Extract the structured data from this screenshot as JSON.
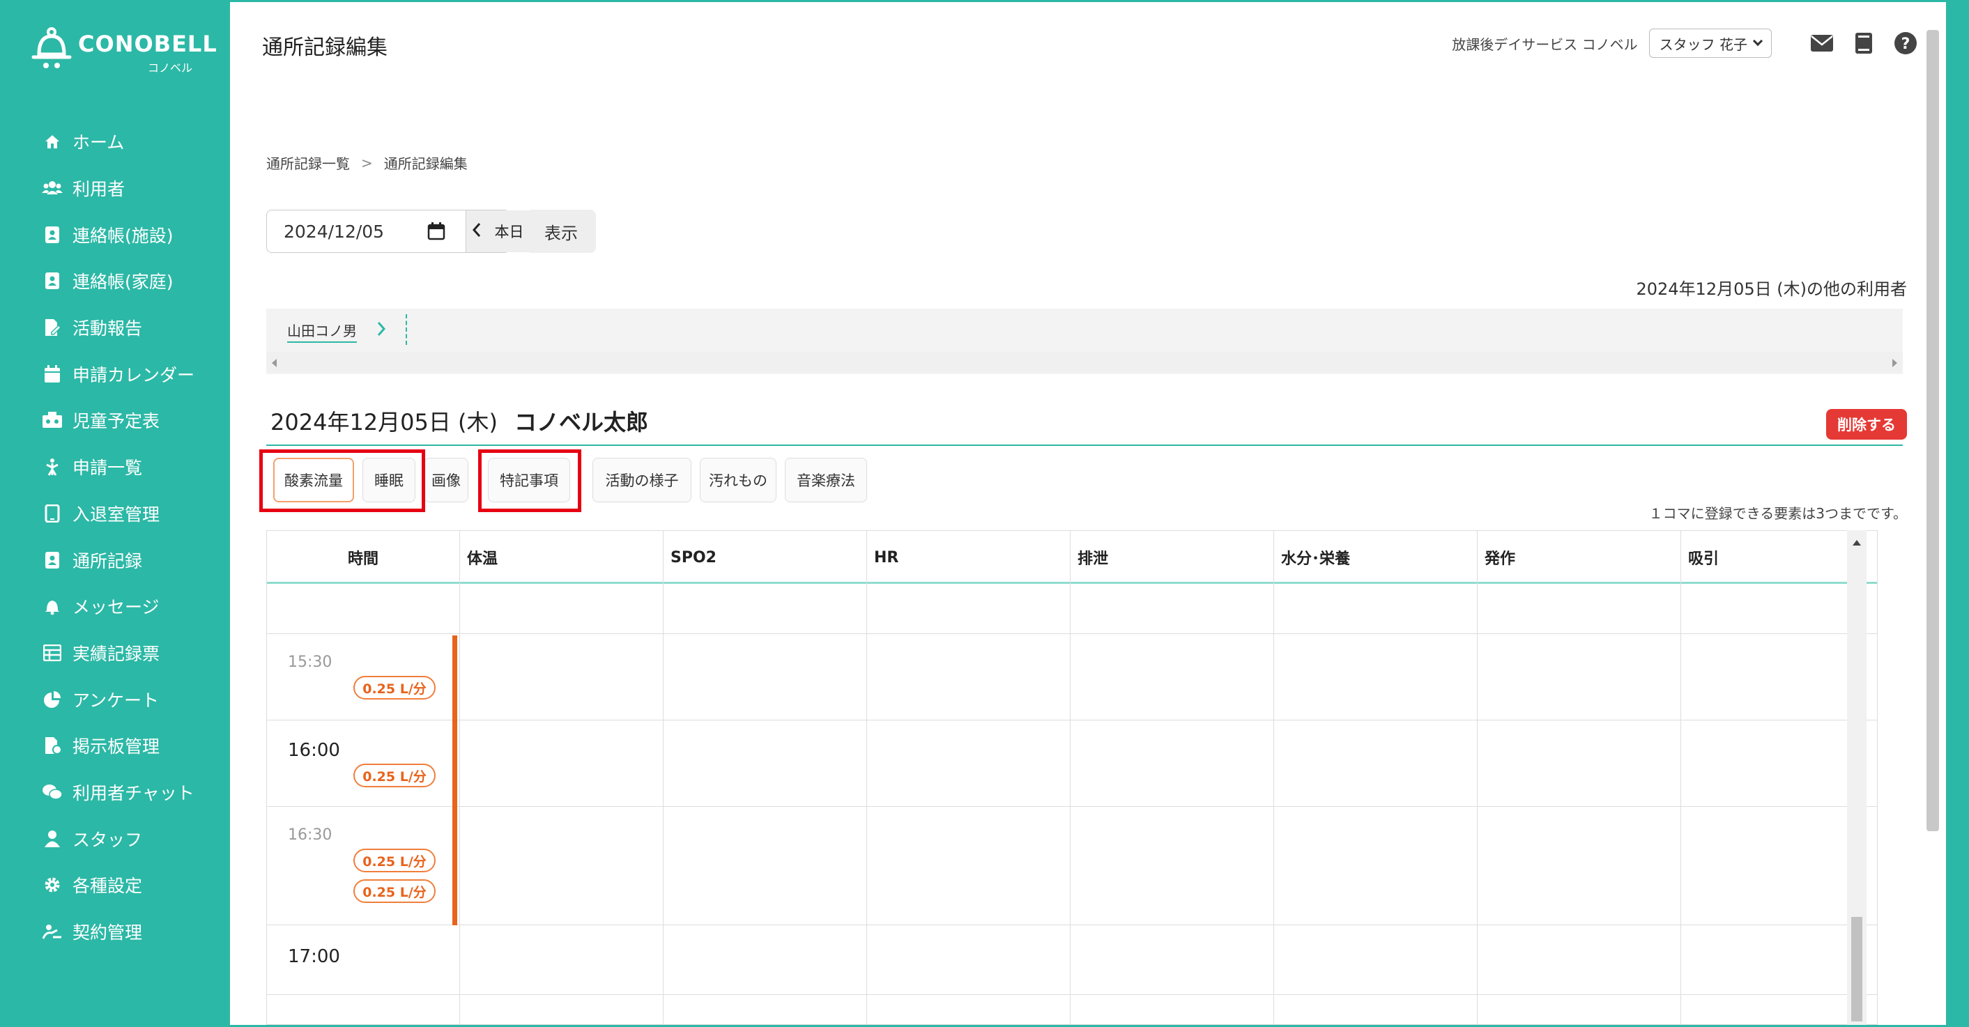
{
  "app": {
    "brand": "CONOBELL",
    "brand_sub": "コノベル"
  },
  "sidebar": {
    "items": [
      {
        "label": "ホーム",
        "icon": "home-icon"
      },
      {
        "label": "利用者",
        "icon": "users-icon"
      },
      {
        "label": "連絡帳(施設)",
        "icon": "contact-book-icon"
      },
      {
        "label": "連絡帳(家庭)",
        "icon": "contact-book-icon"
      },
      {
        "label": "活動報告",
        "icon": "report-icon"
      },
      {
        "label": "申請カレンダー",
        "icon": "calendar-icon"
      },
      {
        "label": "児童予定表",
        "icon": "schedule-icon"
      },
      {
        "label": "申請一覧",
        "icon": "request-list-icon"
      },
      {
        "label": "入退室管理",
        "icon": "tablet-icon"
      },
      {
        "label": "通所記録",
        "icon": "record-icon"
      },
      {
        "label": "メッセージ",
        "icon": "bell-icon"
      },
      {
        "label": "実績記録票",
        "icon": "table-icon"
      },
      {
        "label": "アンケート",
        "icon": "pie-chart-icon"
      },
      {
        "label": "掲示板管理",
        "icon": "board-icon"
      },
      {
        "label": "利用者チャット",
        "icon": "chat-icon"
      },
      {
        "label": "スタッフ",
        "icon": "staff-icon"
      },
      {
        "label": "各種設定",
        "icon": "gear-icon"
      },
      {
        "label": "契約管理",
        "icon": "contract-icon"
      }
    ]
  },
  "header": {
    "title": "通所記録編集",
    "facility": "放課後デイサービス コノベル",
    "staff": "スタッフ 花子"
  },
  "breadcrumb": {
    "item1": "通所記録一覧",
    "sep": ">",
    "item2": "通所記録編集"
  },
  "datebar": {
    "date": "2024/12/05",
    "today": "本日",
    "show": "表示"
  },
  "others": {
    "label": "2024年12月05日 (木)の他の利用者",
    "user": "山田コノ男"
  },
  "record": {
    "date": "2024年12月05日 (木)",
    "name": "コノベル太郎",
    "delete": "削除する"
  },
  "tabs": [
    "酸素流量",
    "睡眠",
    "画像",
    "特記事項",
    "活動の様子",
    "汚れもの",
    "音楽療法"
  ],
  "limit_note": "１コマに登録できる要素は3つまでです。",
  "grid": {
    "headers": [
      "時間",
      "体温",
      "SPO2",
      "HR",
      "排泄",
      "水分･栄養",
      "発作",
      "吸引"
    ],
    "rows": [
      {
        "time": "",
        "badges": []
      },
      {
        "time": "15:30",
        "badges": [
          "0.25 L/分"
        ]
      },
      {
        "time": "16:00",
        "badges": [
          "0.25 L/分"
        ]
      },
      {
        "time": "16:30",
        "badges": [
          "0.25 L/分",
          "0.25 L/分"
        ]
      },
      {
        "time": "17:00",
        "badges": []
      }
    ]
  },
  "colors": {
    "accent": "#2cb8a6",
    "oxygen": "#e8631c",
    "delete": "#e53935",
    "highlight": "#e60012"
  }
}
